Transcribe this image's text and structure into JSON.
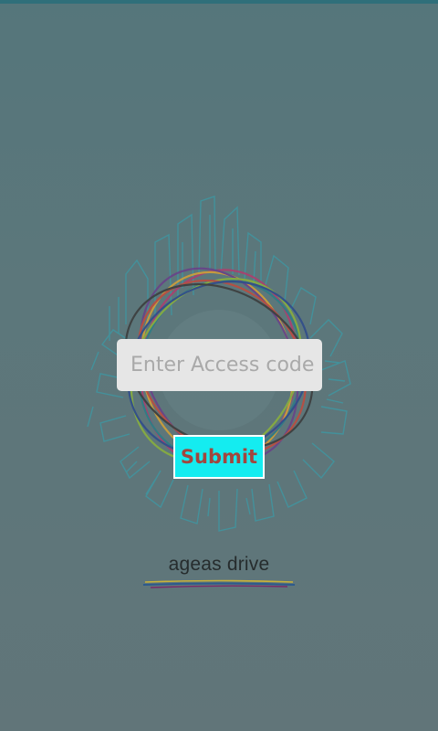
{
  "colors": {
    "background": "#5b777b",
    "input_background": "#e6e6e6",
    "button_background": "#14ecf0",
    "button_text": "#a2463e",
    "brand_text": "#262c2d"
  },
  "icons": {
    "emblem": "city-circle-emblem-icon",
    "swoosh": "brand-swoosh-icon"
  },
  "form": {
    "access_code_placeholder": "Enter Access code",
    "access_code_value": "",
    "submit_label": "Submit"
  },
  "brand": {
    "name": "ageas drive"
  }
}
